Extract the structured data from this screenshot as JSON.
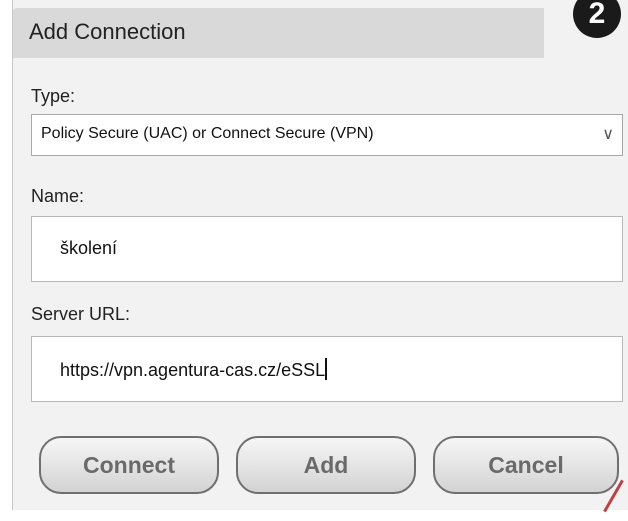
{
  "dialog": {
    "title": "Add Connection",
    "step_number": "2"
  },
  "type": {
    "label": "Type:",
    "selected": "Policy Secure (UAC) or Connect Secure (VPN)"
  },
  "name": {
    "label": "Name:",
    "value": "školení"
  },
  "server_url": {
    "label": "Server URL:",
    "value": "https://vpn.agentura-cas.cz/eSSL"
  },
  "buttons": {
    "connect": "Connect",
    "add": "Add",
    "cancel": "Cancel"
  }
}
